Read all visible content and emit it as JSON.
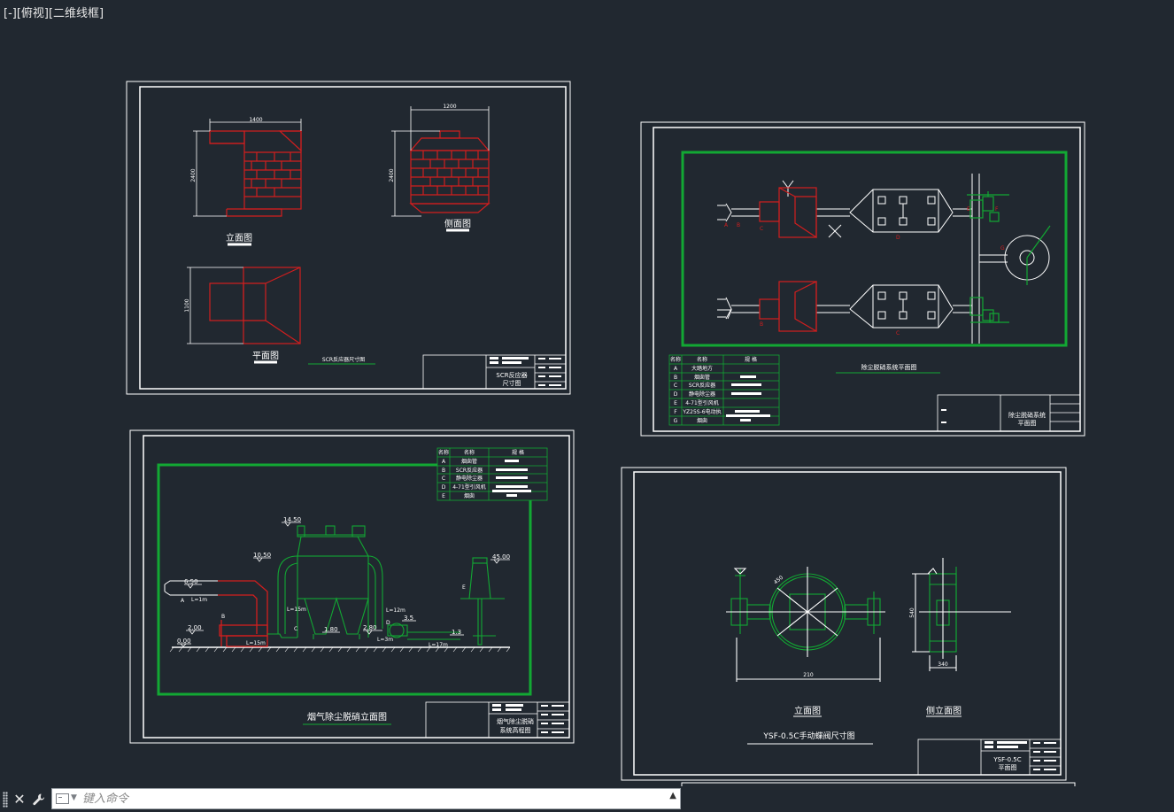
{
  "viewport": {
    "label": "[-][俯视][二维线框]"
  },
  "command_line": {
    "placeholder": "键入命令",
    "close_icon": "close-icon",
    "customize_icon": "wrench-icon",
    "prompt_icon": "command-prompt-icon",
    "history_icon": "chevron-up-icon"
  },
  "colors": {
    "background": "#212830",
    "white": "#ffffff",
    "red": "#d21e1e",
    "green": "#12a833",
    "lightgreen": "#33cc44"
  },
  "sheet1": {
    "elevation_label": "立面图",
    "side_label": "侧面图",
    "plan_label": "平面图",
    "dim_top1": "1400",
    "dim_top2": "1200",
    "dim_side1": "2400",
    "dim_side2": "2400",
    "dim_plan": "1100",
    "caption": "SCR反应器尺寸图",
    "title_block": {
      "line1": "SCR反应器",
      "line2": "尺寸图"
    }
  },
  "sheet2": {
    "labels": {
      "A": "A",
      "B": "B",
      "C": "C",
      "D": "D",
      "E": "E",
      "F": "F",
      "G": "G"
    },
    "table": {
      "header": [
        "名称",
        "名称",
        "规 格"
      ],
      "rows": [
        [
          "A",
          "大踏地方"
        ],
        [
          "B",
          "烟囱管"
        ],
        [
          "C",
          "SCR反应器"
        ],
        [
          "D",
          "静电除尘器"
        ],
        [
          "E",
          "4-71型引风机"
        ],
        [
          "F",
          "YZ25S-6电动执"
        ],
        [
          "G",
          "烟囱"
        ]
      ]
    },
    "caption": "除尘脱硝系统平面图",
    "title_block": {
      "line1": "除尘脱硝系统",
      "line2": "平面图"
    }
  },
  "sheet3": {
    "table": {
      "header": [
        "名称",
        "名称",
        "规 格"
      ],
      "rows": [
        [
          "A",
          "烟囱管"
        ],
        [
          "B",
          "SCR反应器"
        ],
        [
          "C",
          "静电除尘器"
        ],
        [
          "D",
          "4-71型引风机"
        ],
        [
          "E",
          "烟囱"
        ]
      ]
    },
    "elevations": {
      "e1": "14.50",
      "e2": "10.50",
      "e3": "6.50",
      "e4": "2.00",
      "e5": "0.00",
      "e6": "45.00",
      "e7": "2.80",
      "e8": "3.5",
      "e9": "1.3",
      "e10": "1.80"
    },
    "lengths": {
      "l1": "L=1m",
      "l2": "L=15m",
      "l3": "L=15m",
      "l4": "L=12m",
      "l5": "L=3m",
      "l6": "L=17m"
    },
    "letters": {
      "A": "A",
      "B": "B",
      "C": "C",
      "D": "D",
      "E": "E"
    },
    "caption": "烟气除尘脱硝立面图",
    "title_block": {
      "line1": "烟气除尘脱硝",
      "line2": "系统高程图"
    }
  },
  "sheet4": {
    "elevation_label": "立面图",
    "side_label": "侧立面图",
    "caption": "YSF-0.5C手动蝶阀尺寸图",
    "dims": {
      "d1": "210",
      "d2": "450",
      "d3": "540",
      "d4": "340"
    },
    "title_block": {
      "line1": "YSF-0.5C",
      "line2": "平面图"
    }
  }
}
